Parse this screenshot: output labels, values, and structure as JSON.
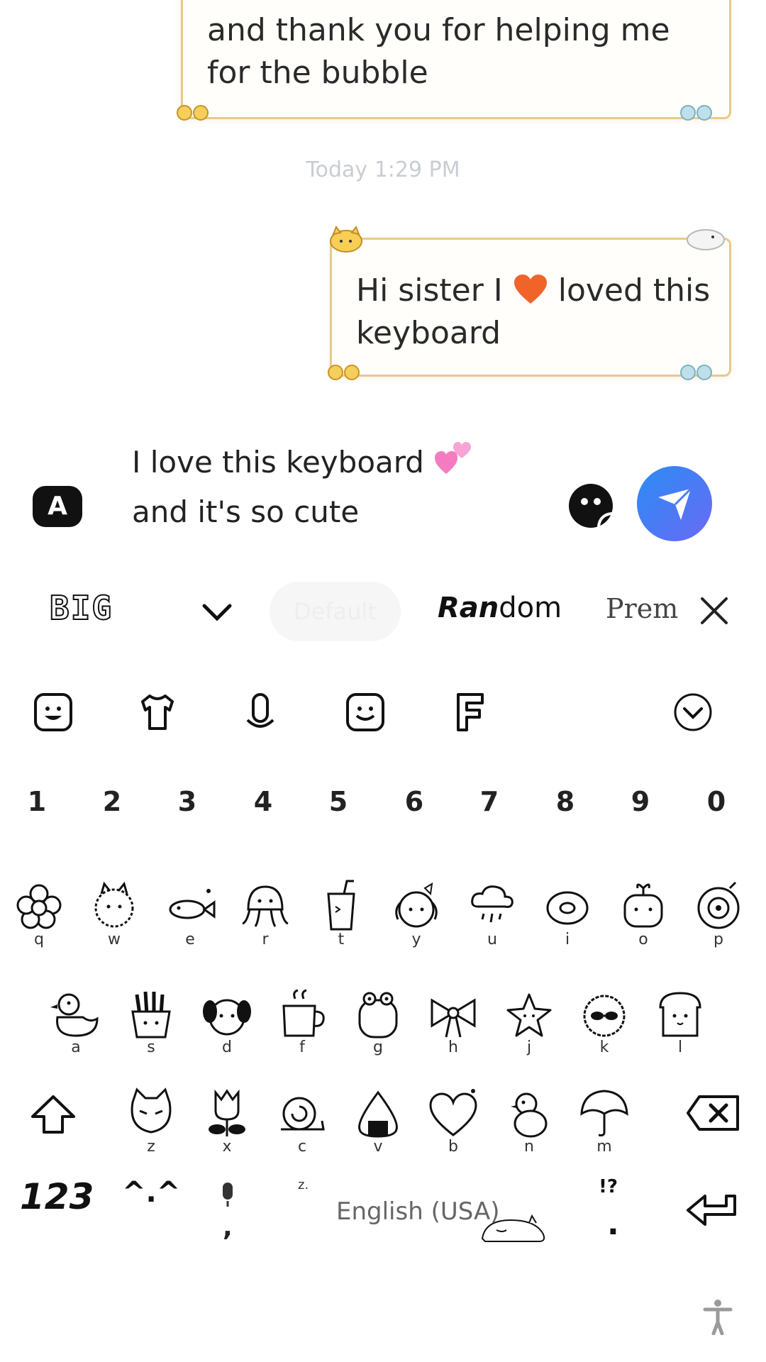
{
  "chat": {
    "message_1_text": "and thank you for helping me for the bubble",
    "timestamp": "Today 1:29 PM",
    "message_2_text_a": "Hi sister I",
    "message_2_text_b": "loved this",
    "message_2_text_c": "keyboard"
  },
  "composer": {
    "badge_label": "A",
    "line_1": "I love this keyboard",
    "line_2": "and it's so cute"
  },
  "font_bar": {
    "big_label": "BIG",
    "pill_label": "Default",
    "random_bold": "Ran",
    "random_rest": "dom",
    "premium_label": "Prem"
  },
  "keyboard": {
    "numbers": [
      "1",
      "2",
      "3",
      "4",
      "5",
      "6",
      "7",
      "8",
      "9",
      "0"
    ],
    "row1": [
      "q",
      "w",
      "e",
      "r",
      "t",
      "y",
      "u",
      "i",
      "o",
      "p"
    ],
    "row2": [
      "a",
      "s",
      "d",
      "f",
      "g",
      "h",
      "j",
      "k",
      "l"
    ],
    "row3": [
      "z",
      "x",
      "c",
      "v",
      "b",
      "n",
      "m"
    ],
    "key_123": "123",
    "key_face": "^.^",
    "space_label": "English (USA)",
    "punct_comma": ",",
    "punct_period": ".",
    "punct_alt": "!?",
    "punct_small": "z."
  },
  "colors": {
    "bubble_border": "#e9c98c",
    "send_gradient_start": "#2b8cf3",
    "send_gradient_end": "#6a6af6",
    "heart_red": "#f0642a",
    "hearts_pink": "#f37cc0"
  },
  "icons": {
    "toolbar": [
      "sticker-face-icon",
      "shirt-theme-icon",
      "microphone-icon",
      "emoji-face-icon",
      "font-f-icon",
      "collapse-chevron-icon"
    ]
  }
}
